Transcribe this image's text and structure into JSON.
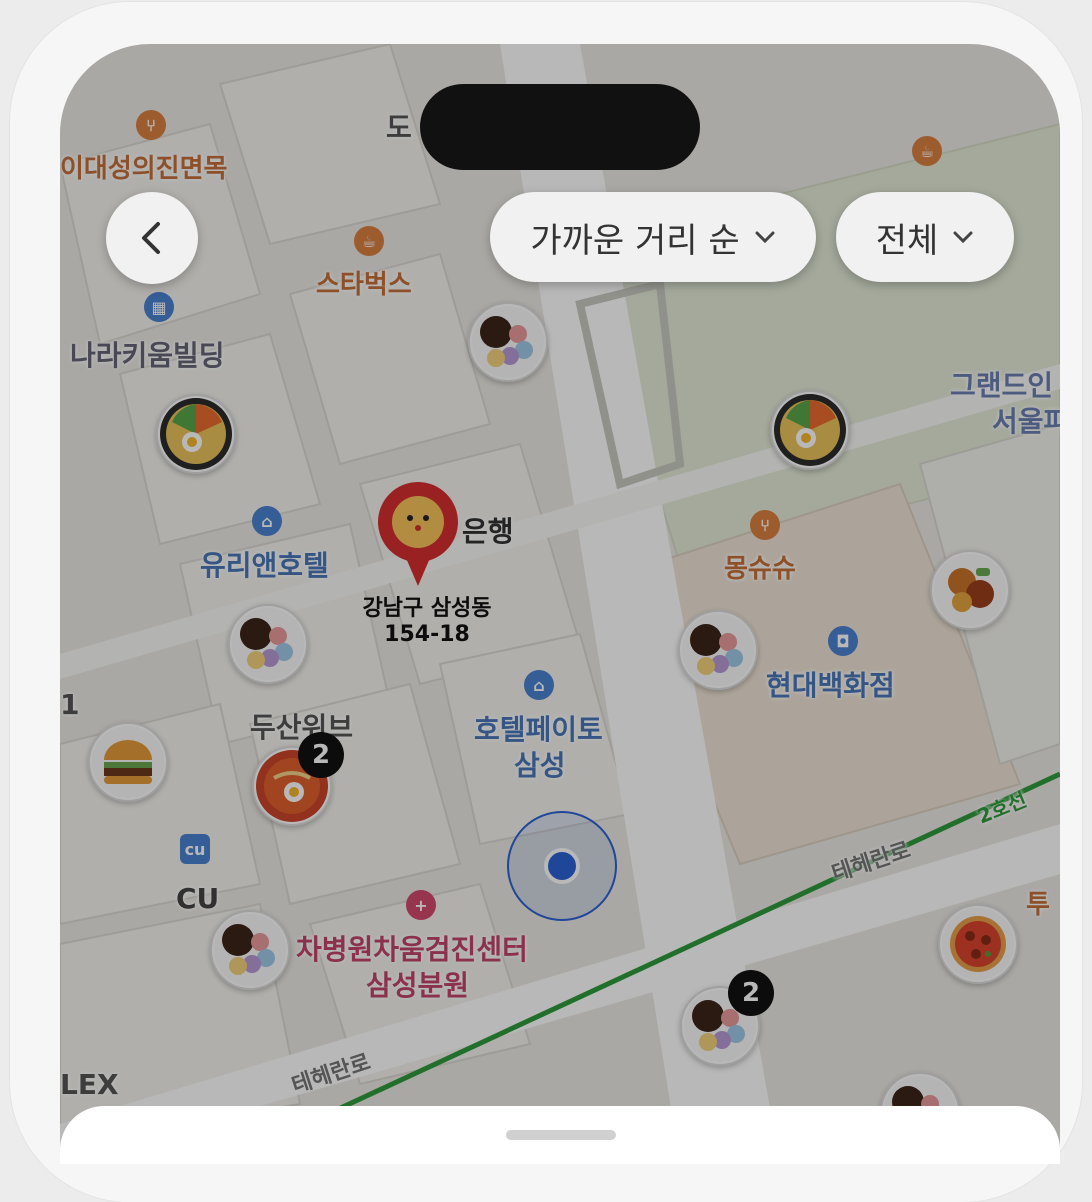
{
  "header": {
    "sort_label": "가까운 거리 순",
    "filter_label": "전체"
  },
  "map": {
    "pin_address_line1": "강남구 삼성동",
    "pin_address_line2": "154-18",
    "pois": {
      "restaurant_top": "이대성의진면목",
      "building_top": "도",
      "starbucks": "스타벅스",
      "starbucks_top_right": "스타벅스",
      "nara_building": "나라키움빌딩",
      "hotel_grand_1": "그랜드인",
      "hotel_grand_2": "서울파",
      "bank": "은행",
      "yurien_hotel": "유리앤호텔",
      "mongsusu": "몽슈슈",
      "hyundai": "현대백화점",
      "doosan": "두산위브",
      "hotel_peito_1": "호텔페이토",
      "hotel_peito_2": "삼성",
      "cu": "CU",
      "hospital_1": "차병원차움검진센터",
      "hospital_2": "삼성분원",
      "teheran_1": "테헤란로",
      "teheran_2": "테헤란로",
      "line2": "2호선",
      "tu": "투",
      "lex": "LEX",
      "edge_1": "1"
    },
    "cluster_counts": {
      "a": "2",
      "b": "2"
    }
  },
  "colors": {
    "accent_pin": "#d42e2e",
    "subway_line": "#2e9a3c",
    "my_location": "#2d62d6"
  }
}
